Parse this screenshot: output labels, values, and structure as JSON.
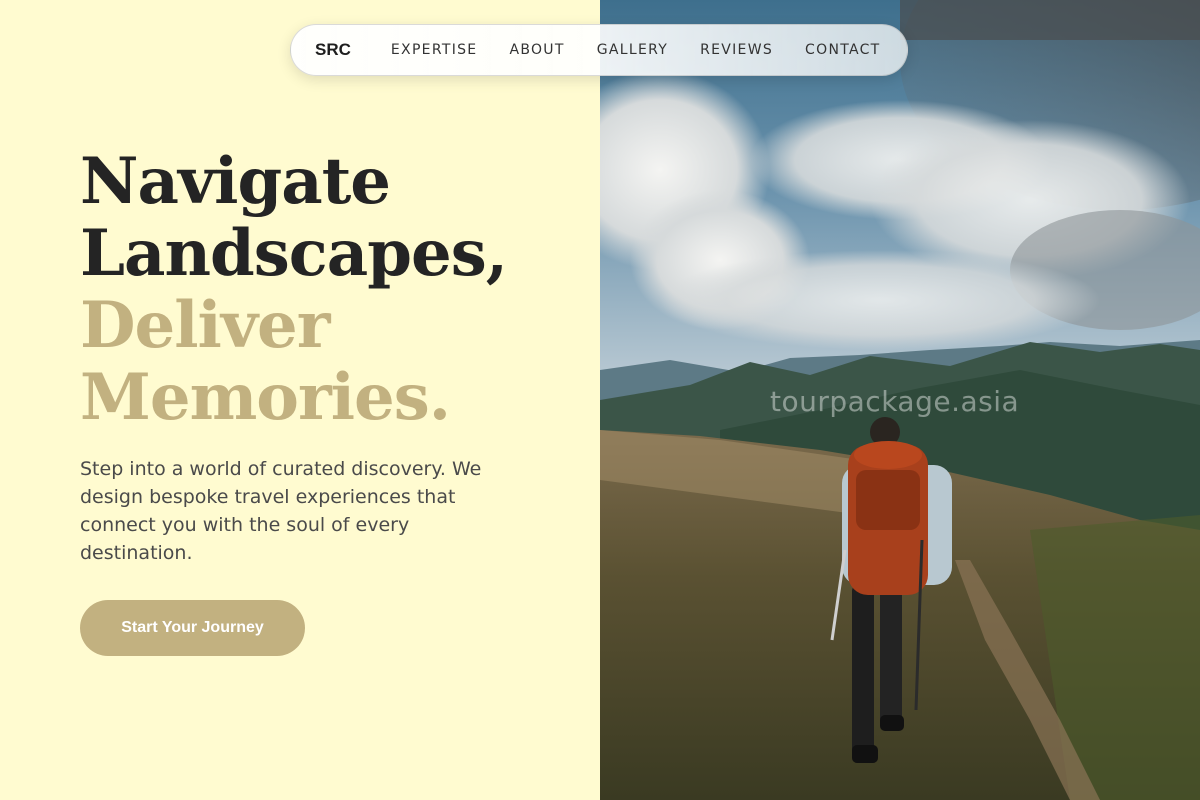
{
  "nav": {
    "logo": "SRC",
    "links": [
      "EXPERTISE",
      "ABOUT",
      "GALLERY",
      "REVIEWS",
      "CONTACT"
    ]
  },
  "hero": {
    "headline_dark": [
      "Navigate",
      "Landscapes,"
    ],
    "headline_light": [
      "Deliver",
      "Memories."
    ],
    "lead": "Step into a world of curated discovery. We design bespoke travel experiences that connect you with the soul of every destination.",
    "cta_label": "Start Your Journey"
  },
  "photo": {
    "watermark": "tourpackage.asia"
  },
  "colors": {
    "background": "#fffbd0",
    "heading_dark": "#242424",
    "accent": "#c2b180",
    "body_text": "#4a4a4a"
  }
}
